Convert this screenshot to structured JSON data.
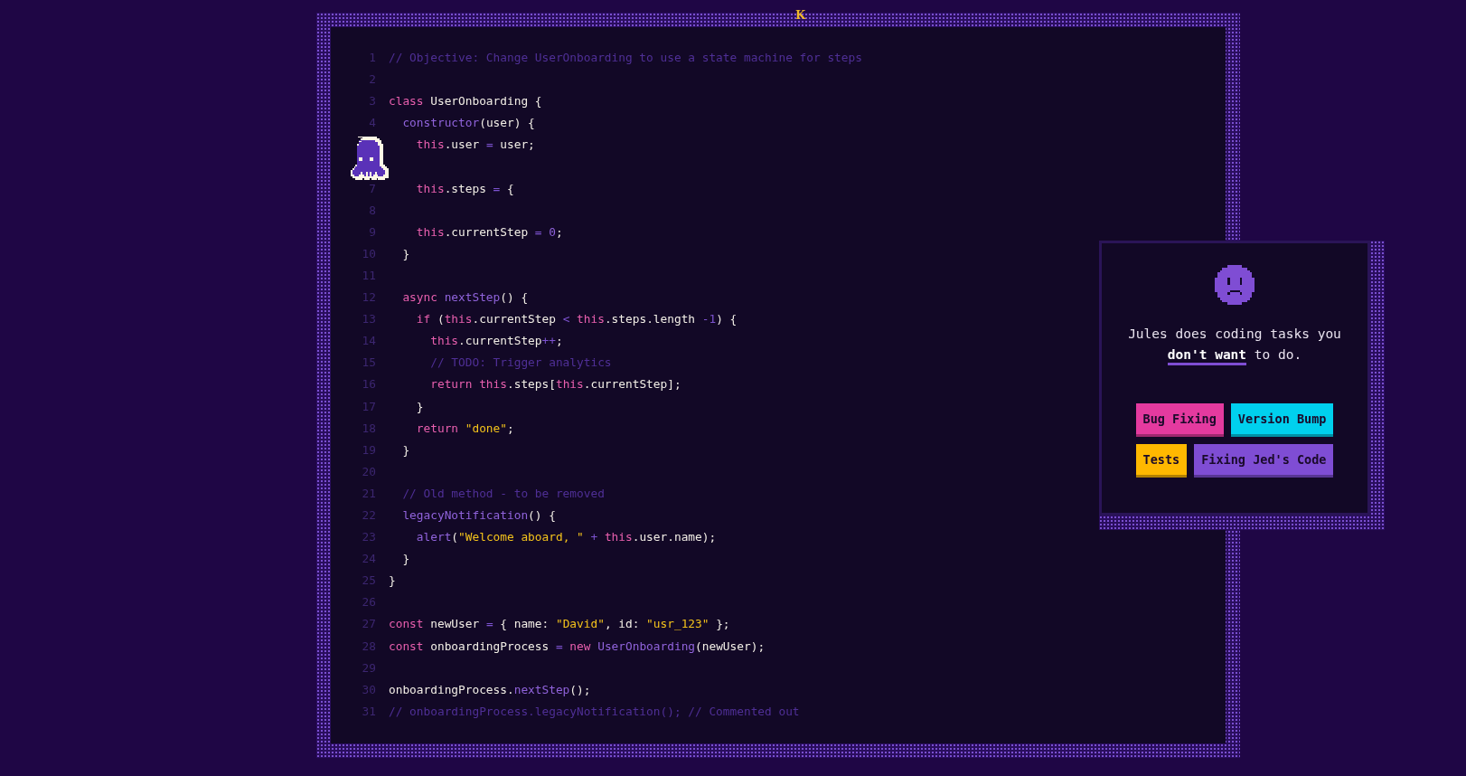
{
  "logo": "K",
  "editor": {
    "lines": [
      {
        "number": "1",
        "tokens": [
          {
            "kind": "comment",
            "text": "// Objective: Change UserOnboarding to use a state machine for steps"
          }
        ]
      },
      {
        "number": "2"
      },
      {
        "number": "3",
        "tokens": [
          {
            "kind": "keyword",
            "text": "class"
          },
          {
            "kind": "plain",
            "text": " UserOnboarding {"
          }
        ]
      },
      {
        "number": "4",
        "tokens": [
          {
            "kind": "function",
            "text": "  constructor"
          },
          {
            "kind": "plain",
            "text": "(user) {"
          }
        ]
      },
      {
        "tokens": [
          {
            "kind": "keyword",
            "text": "    this"
          },
          {
            "kind": "plain",
            "text": ".user "
          },
          {
            "kind": "operator",
            "text": "="
          },
          {
            "kind": "plain",
            "text": " user;"
          }
        ],
        "blank_after": true
      },
      {
        "number": "7",
        "tokens": [
          {
            "kind": "keyword",
            "text": "    this"
          },
          {
            "kind": "plain",
            "text": ".steps "
          },
          {
            "kind": "operator",
            "text": "="
          },
          {
            "kind": "plain",
            "text": " {"
          }
        ]
      },
      {
        "number": "8"
      },
      {
        "number": "9",
        "tokens": [
          {
            "kind": "keyword",
            "text": "    this"
          },
          {
            "kind": "plain",
            "text": ".currentStep "
          },
          {
            "kind": "operator",
            "text": "="
          },
          {
            "kind": "number",
            "text": " 0"
          },
          {
            "kind": "plain",
            "text": ";"
          }
        ]
      },
      {
        "number": "10",
        "tokens": [
          {
            "kind": "plain",
            "text": "  }"
          }
        ]
      },
      {
        "number": "11"
      },
      {
        "number": "12",
        "tokens": [
          {
            "kind": "keyword",
            "text": "  async"
          },
          {
            "kind": "function",
            "text": " nextStep"
          },
          {
            "kind": "plain",
            "text": "() {"
          }
        ]
      },
      {
        "number": "13",
        "tokens": [
          {
            "kind": "keyword",
            "text": "    if"
          },
          {
            "kind": "plain",
            "text": " ("
          },
          {
            "kind": "keyword",
            "text": "this"
          },
          {
            "kind": "plain",
            "text": ".currentStep "
          },
          {
            "kind": "operator",
            "text": "<"
          },
          {
            "kind": "keyword",
            "text": " this"
          },
          {
            "kind": "plain",
            "text": ".steps.length "
          },
          {
            "kind": "operator",
            "text": "-1"
          },
          {
            "kind": "plain",
            "text": ") {"
          }
        ]
      },
      {
        "number": "14",
        "tokens": [
          {
            "kind": "keyword",
            "text": "      this"
          },
          {
            "kind": "plain",
            "text": ".currentStep"
          },
          {
            "kind": "operator",
            "text": "++"
          },
          {
            "kind": "plain",
            "text": ";"
          }
        ]
      },
      {
        "number": "15",
        "tokens": [
          {
            "kind": "comment",
            "text": "      // TODO: Trigger analytics"
          }
        ]
      },
      {
        "number": "16",
        "tokens": [
          {
            "kind": "keyword",
            "text": "      return this"
          },
          {
            "kind": "plain",
            "text": ".steps["
          },
          {
            "kind": "keyword",
            "text": "this"
          },
          {
            "kind": "plain",
            "text": ".currentStep];"
          }
        ]
      },
      {
        "number": "17",
        "tokens": [
          {
            "kind": "plain",
            "text": "    }"
          }
        ]
      },
      {
        "number": "18",
        "tokens": [
          {
            "kind": "keyword",
            "text": "    return"
          },
          {
            "kind": "string",
            "text": " \"done\""
          },
          {
            "kind": "plain",
            "text": ";"
          }
        ]
      },
      {
        "number": "19",
        "tokens": [
          {
            "kind": "plain",
            "text": "  }"
          }
        ]
      },
      {
        "number": "20"
      },
      {
        "number": "21",
        "tokens": [
          {
            "kind": "comment",
            "text": "  // Old method - to be removed"
          }
        ]
      },
      {
        "number": "22",
        "tokens": [
          {
            "kind": "function",
            "text": "  legacyNotification"
          },
          {
            "kind": "plain",
            "text": "() {"
          }
        ]
      },
      {
        "number": "23",
        "tokens": [
          {
            "kind": "function",
            "text": "    alert"
          },
          {
            "kind": "plain",
            "text": "("
          },
          {
            "kind": "string",
            "text": "\"Welcome aboard, \""
          },
          {
            "kind": "operator",
            "text": " +"
          },
          {
            "kind": "keyword",
            "text": " this"
          },
          {
            "kind": "plain",
            "text": ".user.name);"
          }
        ]
      },
      {
        "number": "24",
        "tokens": [
          {
            "kind": "plain",
            "text": "  }"
          }
        ]
      },
      {
        "number": "25",
        "tokens": [
          {
            "kind": "plain",
            "text": "}"
          }
        ]
      },
      {
        "number": "26"
      },
      {
        "number": "27",
        "tokens": [
          {
            "kind": "keyword",
            "text": "const"
          },
          {
            "kind": "plain",
            "text": " newUser "
          },
          {
            "kind": "operator",
            "text": "="
          },
          {
            "kind": "plain",
            "text": " { name: "
          },
          {
            "kind": "string",
            "text": "\"David\""
          },
          {
            "kind": "plain",
            "text": ", id: "
          },
          {
            "kind": "string",
            "text": "\"usr_123\""
          },
          {
            "kind": "plain",
            "text": " };"
          }
        ]
      },
      {
        "number": "28",
        "tokens": [
          {
            "kind": "keyword",
            "text": "const"
          },
          {
            "kind": "plain",
            "text": " onboardingProcess "
          },
          {
            "kind": "operator",
            "text": "="
          },
          {
            "kind": "keyword",
            "text": " new"
          },
          {
            "kind": "function",
            "text": " UserOnboarding"
          },
          {
            "kind": "plain",
            "text": "(newUser);"
          }
        ]
      },
      {
        "number": "29"
      },
      {
        "number": "30",
        "tokens": [
          {
            "kind": "plain",
            "text": "onboardingProcess."
          },
          {
            "kind": "function",
            "text": "nextStep"
          },
          {
            "kind": "plain",
            "text": "();"
          }
        ]
      },
      {
        "number": "31",
        "tokens": [
          {
            "kind": "comment",
            "text": "// onboardingProcess.legacyNotification(); // Commented out"
          }
        ]
      }
    ]
  },
  "card": {
    "text": "Jules does coding tasks you **don't want** to do.",
    "tags": [
      {
        "label": "Bug Fixing",
        "color": "#e43a9f"
      },
      {
        "label": "Version Bump",
        "color": "#00d0ee"
      },
      {
        "label": "Tests",
        "color": "#ffb800"
      },
      {
        "label": "Fixing Jed's Code",
        "color": "#7f4dd4"
      }
    ]
  }
}
